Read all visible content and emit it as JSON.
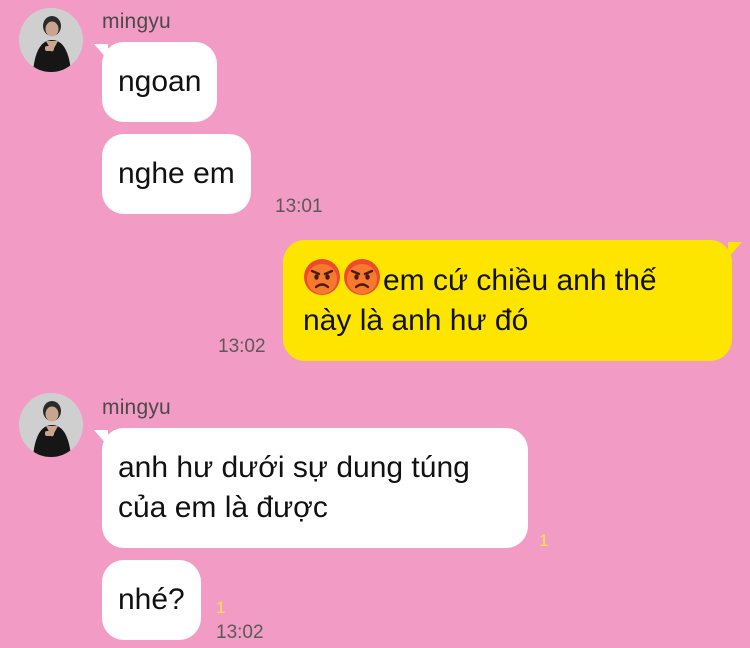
{
  "colors": {
    "background": "#f29bc4",
    "incoming_bubble": "#ffffff",
    "outgoing_bubble": "#fee500",
    "unread_count": "#ffe14a"
  },
  "messages": [
    {
      "sender": "mingyu",
      "bubbles": [
        "ngoan",
        "nghe em"
      ],
      "time": "13:01"
    },
    {
      "sender": "me",
      "emoji": [
        "pouting-face-emoji",
        "pouting-face-emoji"
      ],
      "text": "em cứ chiều anh thế\nnày là anh hư đó",
      "time": "13:02"
    },
    {
      "sender": "mingyu",
      "bubbles": [
        "anh hư dưới sự dung túng\ncủa em là được",
        "nhé?"
      ],
      "unread": [
        "1",
        "1"
      ],
      "time": "13:02"
    }
  ]
}
